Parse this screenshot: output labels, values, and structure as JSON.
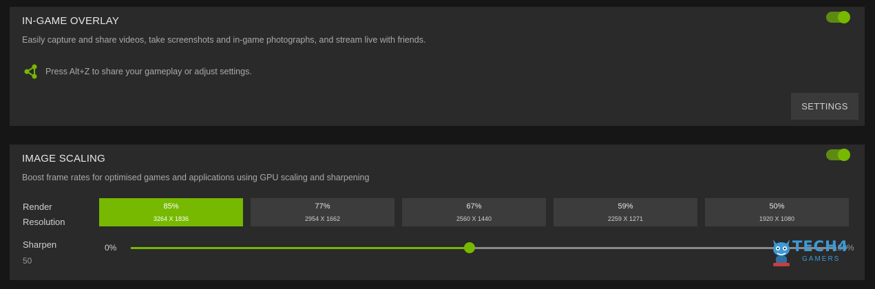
{
  "overlay": {
    "title": "IN-GAME OVERLAY",
    "description": "Easily capture and share videos, take screenshots and in-game photographs, and stream live with friends.",
    "enabled": true,
    "share_hint": "Press Alt+Z to share your gameplay or adjust settings.",
    "settings_label": "SETTINGS"
  },
  "image_scaling": {
    "title": "IMAGE SCALING",
    "description": "Boost frame rates for optimised games and applications using GPU scaling and sharpening",
    "enabled": true,
    "render_label": "Render Resolution",
    "resolutions": [
      {
        "percent": "85%",
        "dims": "3264 X 1836",
        "selected": true
      },
      {
        "percent": "77%",
        "dims": "2954 X 1662",
        "selected": false
      },
      {
        "percent": "67%",
        "dims": "2560 X 1440",
        "selected": false
      },
      {
        "percent": "59%",
        "dims": "2259 X 1271",
        "selected": false
      },
      {
        "percent": "50%",
        "dims": "1920 X 1080",
        "selected": false
      }
    ],
    "sharpen_label": "Sharpen",
    "sharpen_value": "50",
    "sharpen_fraction": 0.48,
    "slider_min": "0%",
    "slider_max": "100%"
  },
  "watermark": {
    "line1": "TECH4",
    "line2": "GAMERS"
  },
  "colors": {
    "accent": "#76b900",
    "panel": "#2a2a2a",
    "background": "#161616",
    "watermark": "#3d9ad6"
  },
  "icons": {
    "share": "share-icon",
    "toggle": "toggle-switch"
  }
}
